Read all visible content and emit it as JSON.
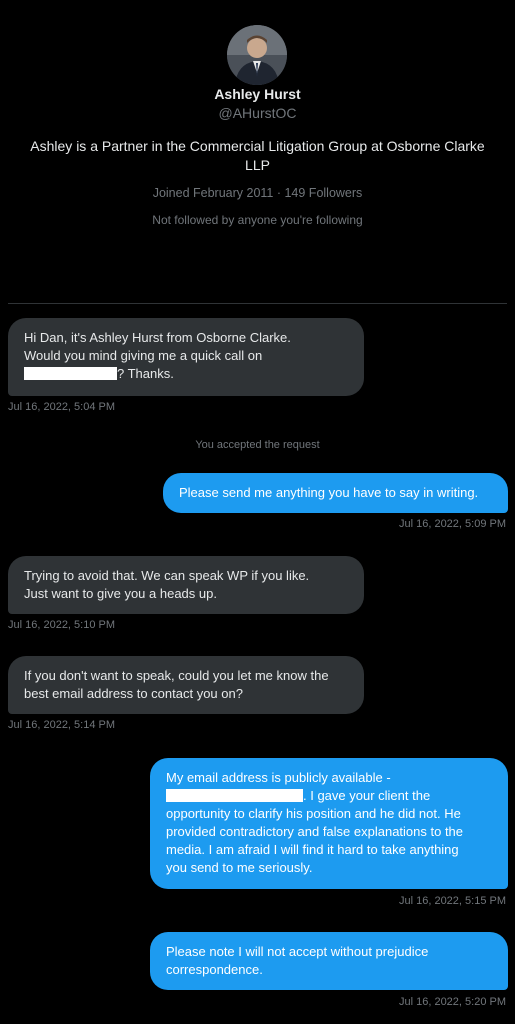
{
  "profile": {
    "name": "Ashley Hurst",
    "handle": "@AHurstOC",
    "bio": "Ashley is a Partner in the Commercial Litigation Group at Osborne Clarke LLP",
    "meta": "Joined February 2011 · 149 Followers",
    "followed_note": "Not followed by anyone you're following"
  },
  "system_message": "You accepted the request",
  "messages": [
    {
      "direction": "in",
      "line1": "Hi Dan, it's Ashley Hurst from Osborne Clarke.",
      "line2": "Would you mind giving me a quick call on",
      "line3_after_redaction": "? Thanks.",
      "timestamp": "Jul 16, 2022, 5:04 PM"
    },
    {
      "direction": "out",
      "text": "Please send me anything you have to say in writing.",
      "timestamp": "Jul 16, 2022, 5:09 PM"
    },
    {
      "direction": "in",
      "line1": "Trying to avoid that. We can speak WP if you like.",
      "line2": "Just want to give you a heads up.",
      "timestamp": "Jul 16, 2022, 5:10 PM"
    },
    {
      "direction": "in",
      "line1": "If you don't want to speak, could you let me know the",
      "line2": "best email address to contact you on?",
      "timestamp": "Jul 16, 2022, 5:14 PM"
    },
    {
      "direction": "out",
      "line1": "My email address is publicly available -",
      "line2_after_redaction": ". I gave your client the",
      "line3": "opportunity to clarify his position and he did not. He",
      "line4": "provided contradictory and false explanations to the",
      "line5": "media. I am afraid I will find it hard to take anything",
      "line6": "you send to me seriously.",
      "timestamp": "Jul 16, 2022, 5:15 PM"
    },
    {
      "direction": "out",
      "line1": "Please note I will not accept without prejudice",
      "line2": "correspondence.",
      "timestamp": "Jul 16, 2022, 5:20 PM"
    }
  ],
  "colors": {
    "background": "#000000",
    "incoming_bubble": "#2f3336",
    "outgoing_bubble": "#1d9bf0",
    "secondary_text": "#71767b"
  }
}
